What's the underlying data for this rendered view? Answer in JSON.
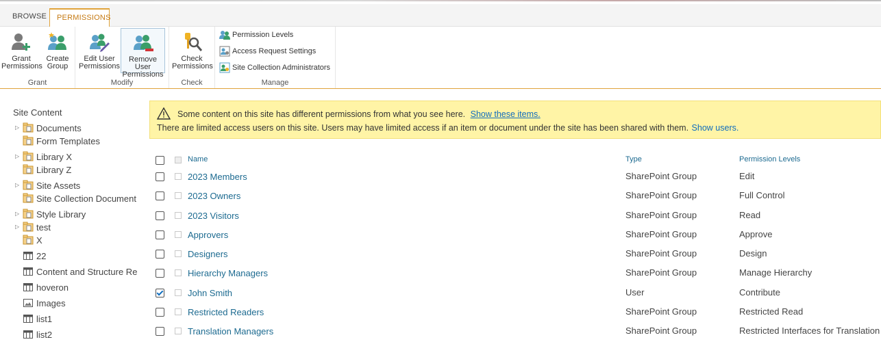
{
  "ribbon_tabs": {
    "browse": "BROWSE",
    "permissions": "PERMISSIONS"
  },
  "ribbon": {
    "grant": {
      "label": "Grant",
      "grant_permissions": "Grant\nPermissions",
      "create_group": "Create\nGroup"
    },
    "modify": {
      "label": "Modify",
      "edit_user_permissions": "Edit User\nPermissions",
      "remove_user_permissions": "Remove User\nPermissions"
    },
    "check": {
      "label": "Check",
      "check_permissions": "Check\nPermissions"
    },
    "manage": {
      "label": "Manage",
      "permission_levels": "Permission Levels",
      "access_request_settings": "Access Request Settings",
      "site_collection_administrators": "Site Collection Administrators"
    }
  },
  "nav": {
    "title": "Site Content",
    "items": [
      {
        "label": "Documents",
        "icon": "folder-library-icon",
        "expandable": true
      },
      {
        "label": "Form Templates",
        "icon": "folder-library-icon",
        "expandable": false
      },
      {
        "label": "Library X",
        "icon": "folder-library-icon",
        "expandable": true
      },
      {
        "label": "Library Z",
        "icon": "folder-library-icon",
        "expandable": false
      },
      {
        "label": "Site Assets",
        "icon": "folder-library-icon",
        "expandable": true
      },
      {
        "label": "Site Collection Document",
        "icon": "folder-library-icon",
        "expandable": false
      },
      {
        "label": "Style Library",
        "icon": "folder-library-icon",
        "expandable": true
      },
      {
        "label": "test",
        "icon": "folder-library-icon",
        "expandable": true
      },
      {
        "label": "X",
        "icon": "folder-library-icon",
        "expandable": false
      },
      {
        "label": "22",
        "icon": "list-icon",
        "expandable": false
      },
      {
        "label": "Content and Structure Re",
        "icon": "list-icon",
        "expandable": false
      },
      {
        "label": "hoveron",
        "icon": "list-icon",
        "expandable": false
      },
      {
        "label": "Images",
        "icon": "image-library-icon",
        "expandable": false
      },
      {
        "label": "list1",
        "icon": "list-icon",
        "expandable": false
      },
      {
        "label": "list2",
        "icon": "list-icon",
        "expandable": false
      }
    ]
  },
  "warning": {
    "line1": "Some content on this site has different permissions from what you see here.",
    "line1_link": "Show these items.",
    "line2": "There are limited access users on this site. Users may have limited access if an item or document under the site has been shared with them.",
    "line2_link": "Show users."
  },
  "table": {
    "headers": {
      "name": "Name",
      "type": "Type",
      "permission_levels": "Permission Levels"
    },
    "rows": [
      {
        "name": "2023 Members",
        "type": "SharePoint Group",
        "perm": "Edit",
        "checked": false
      },
      {
        "name": "2023 Owners",
        "type": "SharePoint Group",
        "perm": "Full Control",
        "checked": false
      },
      {
        "name": "2023 Visitors",
        "type": "SharePoint Group",
        "perm": "Read",
        "checked": false
      },
      {
        "name": "Approvers",
        "type": "SharePoint Group",
        "perm": "Approve",
        "checked": false
      },
      {
        "name": "Designers",
        "type": "SharePoint Group",
        "perm": "Design",
        "checked": false
      },
      {
        "name": "Hierarchy Managers",
        "type": "SharePoint Group",
        "perm": "Manage Hierarchy",
        "checked": false
      },
      {
        "name": "John Smith",
        "type": "User",
        "perm": "Contribute",
        "checked": true
      },
      {
        "name": "Restricted Readers",
        "type": "SharePoint Group",
        "perm": "Restricted Read",
        "checked": false
      },
      {
        "name": "Translation Managers",
        "type": "SharePoint Group",
        "perm": "Restricted Interfaces for Translation",
        "checked": false
      }
    ]
  },
  "colors": {
    "accent": "#e0a33a",
    "link": "#1c6a90",
    "warning_bg": "#fff4a6"
  }
}
